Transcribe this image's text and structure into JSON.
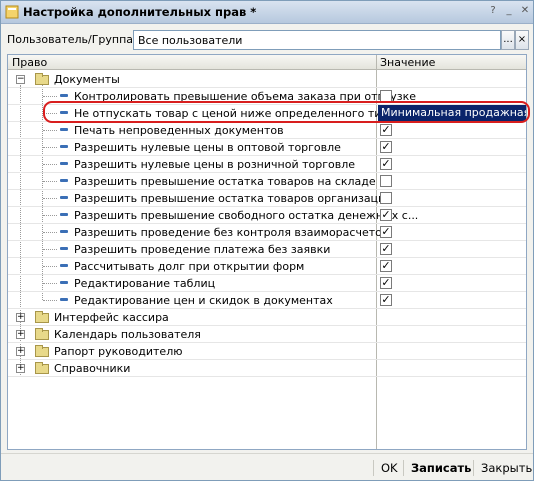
{
  "window": {
    "title": "Настройка дополнительных прав *"
  },
  "user": {
    "label": "Пользователь/Группа:",
    "value": "Все пользователи",
    "select_label": "...",
    "clear_label": "×"
  },
  "grid": {
    "col_right": "Право",
    "col_value": "Значение",
    "rows": [
      {
        "kind": "group",
        "label": "Документы",
        "expanded": true
      },
      {
        "kind": "item",
        "label": "Контролировать превышение объема заказа при отгрузке",
        "checked": false
      },
      {
        "kind": "item",
        "label": "Не отпускать товар с ценой ниже определенного типа",
        "value": "Минимальная продажная",
        "selected": true
      },
      {
        "kind": "item",
        "label": "Печать непроведенных документов",
        "checked": true
      },
      {
        "kind": "item",
        "label": "Разрешить нулевые цены в оптовой торговле",
        "checked": true
      },
      {
        "kind": "item",
        "label": "Разрешить нулевые цены в розничной торговле",
        "checked": true
      },
      {
        "kind": "item",
        "label": "Разрешить превышение остатка товаров на складе",
        "checked": false
      },
      {
        "kind": "item",
        "label": "Разрешить превышение остатка товаров организации",
        "checked": false
      },
      {
        "kind": "item",
        "label": "Разрешить превышение свободного остатка денежных с...",
        "checked": true
      },
      {
        "kind": "item",
        "label": "Разрешить проведение без контроля взаиморасчетов",
        "checked": true
      },
      {
        "kind": "item",
        "label": "Разрешить проведение платежа без заявки",
        "checked": true
      },
      {
        "kind": "item",
        "label": "Рассчитывать долг при открытии форм",
        "checked": true
      },
      {
        "kind": "item",
        "label": "Редактирование таблиц",
        "checked": true
      },
      {
        "kind": "item",
        "label": "Редактирование цен и скидок в документах",
        "checked": true
      },
      {
        "kind": "group",
        "label": "Интерфейс кассира",
        "expanded": false
      },
      {
        "kind": "group",
        "label": "Календарь пользователя",
        "expanded": false
      },
      {
        "kind": "group",
        "label": "Рапорт руководителю",
        "expanded": false
      },
      {
        "kind": "group",
        "label": "Справочники",
        "expanded": false
      }
    ]
  },
  "footer": {
    "ok": "OK",
    "save": "Записать",
    "close": "Закрыть"
  },
  "colors": {
    "selection": "#0a246a",
    "highlight": "#d81e1e",
    "folder": "#e8d98a",
    "leaf": "#3b6fb6"
  }
}
